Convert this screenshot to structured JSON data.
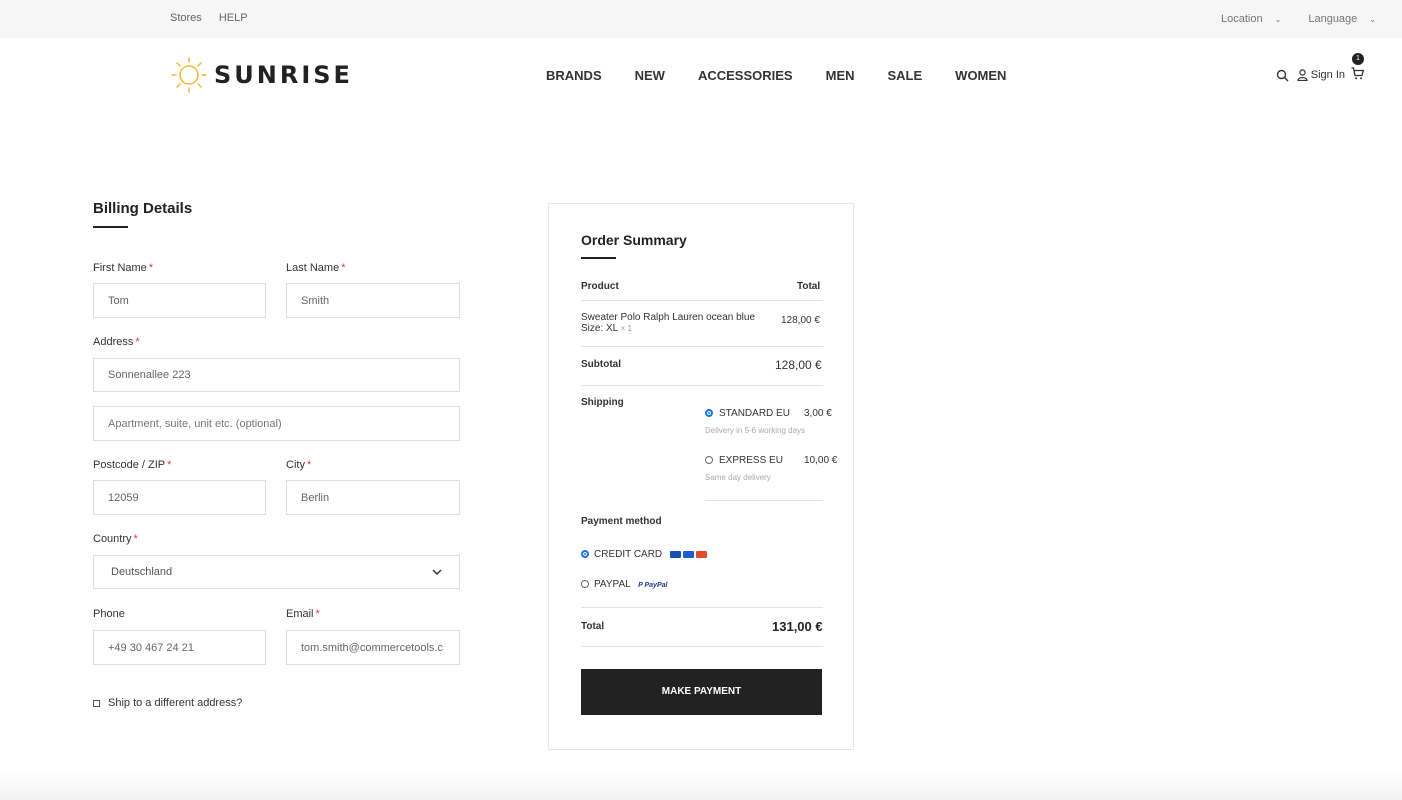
{
  "topbar": {
    "links": [
      "Stores",
      "HELP"
    ],
    "location_label": "Location",
    "language_label": "Language"
  },
  "header": {
    "logo_text": "SUNRISE",
    "nav": [
      "BRANDS",
      "NEW",
      "ACCESSORIES",
      "MEN",
      "SALE",
      "WOMEN"
    ],
    "signin_label": "Sign In",
    "cart_count": "1"
  },
  "billing": {
    "title": "Billing Details",
    "first_name": {
      "label": "First Name",
      "value": "Tom"
    },
    "last_name": {
      "label": "Last Name",
      "value": "Smith"
    },
    "address": {
      "label": "Address",
      "value": "Sonnenallee 223"
    },
    "address2": {
      "placeholder": "Apartment, suite, unit etc. (optional)"
    },
    "postcode": {
      "label": "Postcode / ZIP",
      "value": "12059"
    },
    "city": {
      "label": "City",
      "value": "Berlin"
    },
    "country": {
      "label": "Country",
      "value": "Deutschland"
    },
    "phone": {
      "label": "Phone",
      "value": "+49 30 467 24 21"
    },
    "email": {
      "label": "Email",
      "value": "tom.smith@commercetools.c"
    },
    "ship_different": "Ship to a different address?",
    "required_mark": "*"
  },
  "summary": {
    "title": "Order Summary",
    "col_product": "Product",
    "col_total": "Total",
    "item_name": "Sweater Polo Ralph Lauren ocean blue",
    "item_size": "Size: XL",
    "item_qty": "× 1",
    "item_price": "128,00 €",
    "subtotal_label": "Subtotal",
    "subtotal_value": "128,00 €",
    "shipping_label": "Shipping",
    "shipping_options": [
      {
        "name": "STANDARD EU",
        "price": "3,00 €",
        "note": "Delivery in 5-6 working days",
        "selected": true
      },
      {
        "name": "EXPRESS EU",
        "price": "10,00 €",
        "note": "Same day delivery",
        "selected": false
      }
    ],
    "payment_label": "Payment method",
    "payment_options": [
      {
        "name": "CREDIT CARD",
        "selected": true
      },
      {
        "name": "PAYPAL",
        "selected": false
      }
    ],
    "paypal_logo_text": "PayPal",
    "total_label": "Total",
    "total_value": "131,00 €",
    "pay_button": "MAKE PAYMENT"
  },
  "colors": {
    "accent": "#1e73e8",
    "required": "#e53935",
    "logo_sun": "#f5b638",
    "button_bg": "#222222"
  }
}
